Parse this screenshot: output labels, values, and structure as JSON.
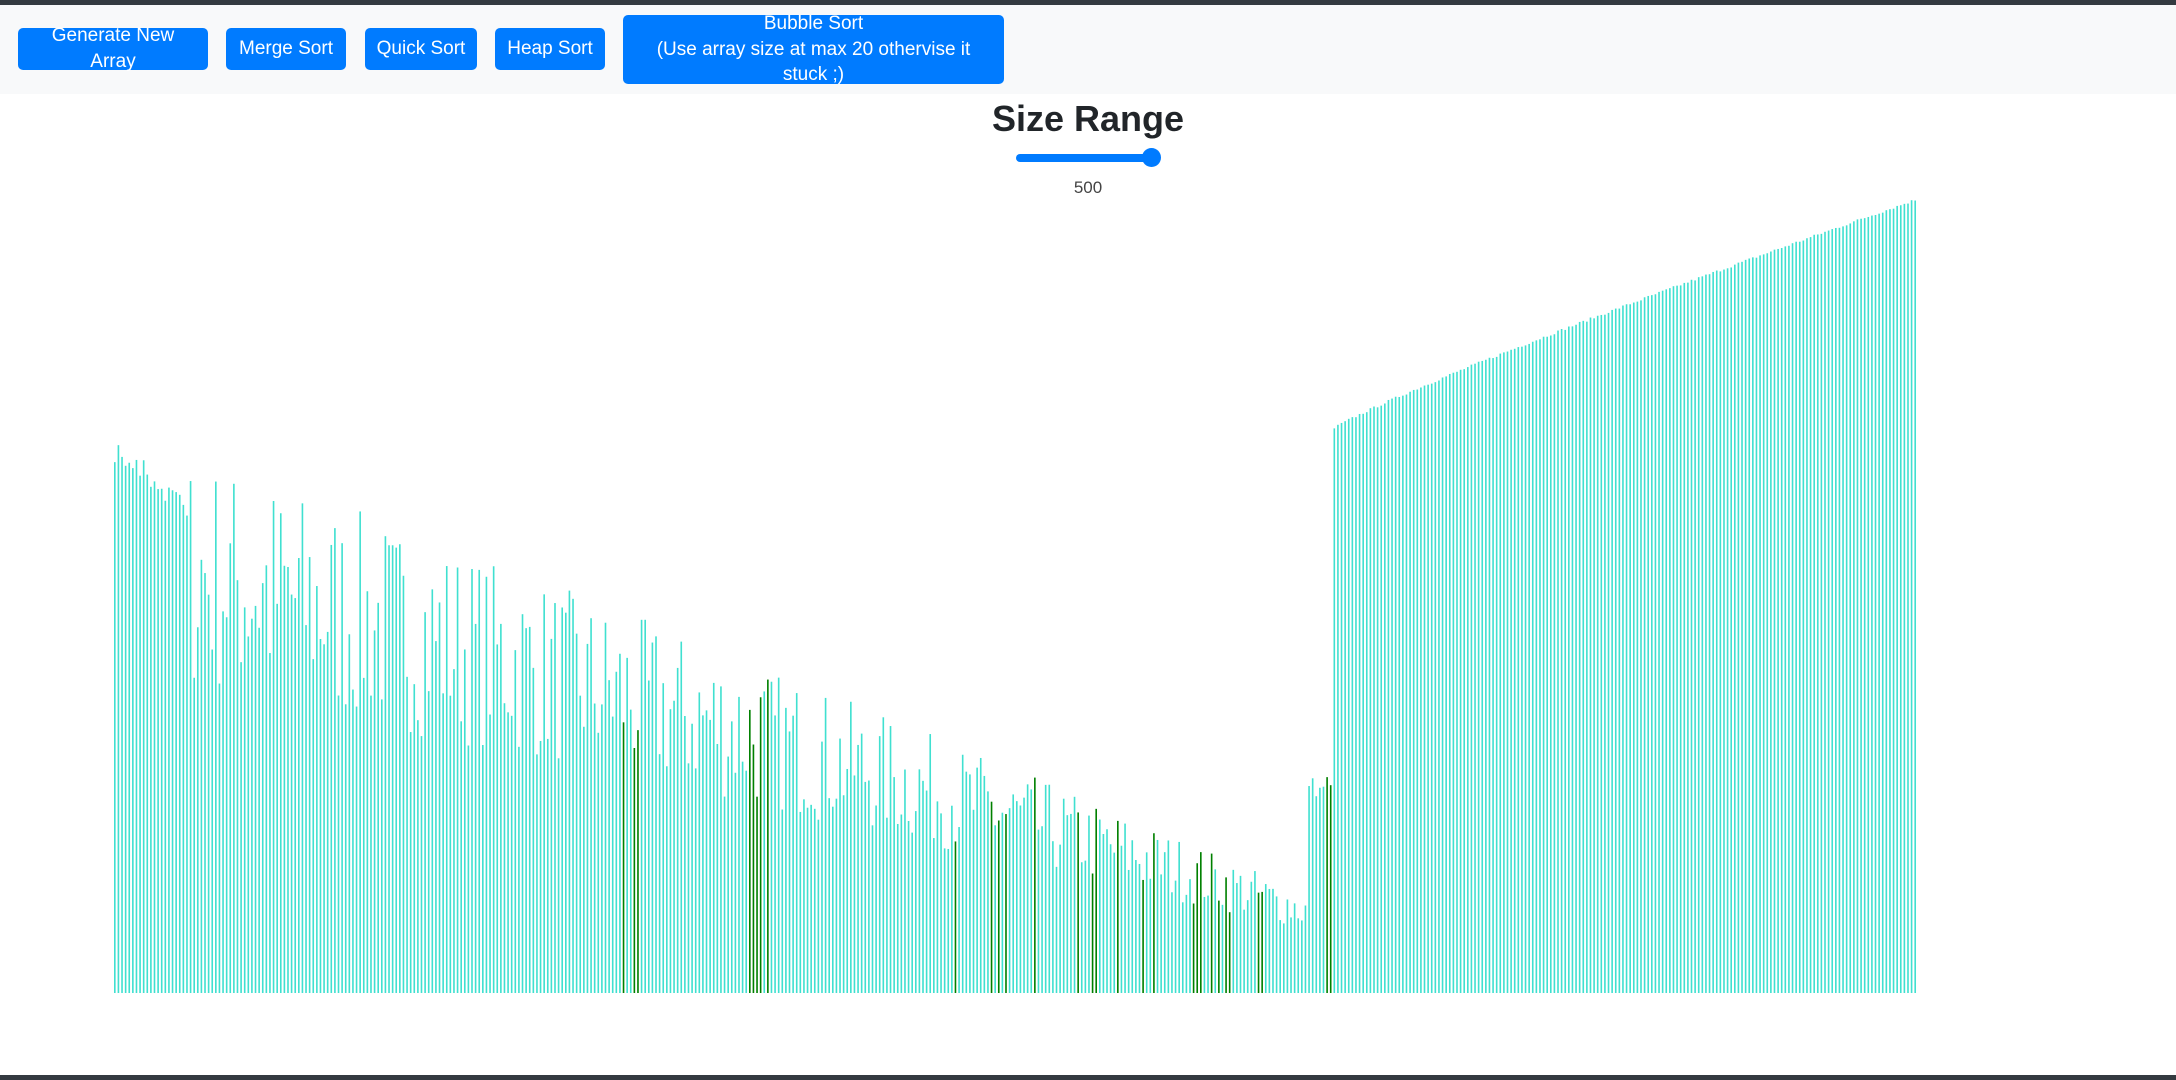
{
  "toolbar": {
    "generate_label": "Generate New Array",
    "merge_label": "Merge Sort",
    "quick_label": "Quick Sort",
    "heap_label": "Heap Sort",
    "bubble_label": "Bubble Sort",
    "bubble_note": "(Use array size at max 20 othervise it stuck ;)"
  },
  "size_range": {
    "title": "Size Range",
    "value": "500",
    "min": 0,
    "max": 500
  },
  "colors": {
    "primary": "#007bff",
    "bar_default": "#40e0d0",
    "bar_active": "#008000",
    "navbar_bg": "#f8f9fa"
  },
  "chart_data": {
    "type": "bar",
    "bar_count": 500,
    "description_colors": [
      "turquoise",
      "green"
    ],
    "regions": {
      "partially_sorted_start": 0,
      "partially_sorted_end": 338,
      "sorted_tail_start": 338,
      "sorted_tail_end": 500
    },
    "value_range": [
      0,
      570
    ],
    "sorted_tail_range": [
      405,
      570
    ],
    "green_bar_indices": [
      141,
      144,
      145,
      176,
      177,
      178,
      179,
      181,
      233,
      243,
      245,
      247,
      255,
      267,
      271,
      272,
      278,
      285,
      288,
      299,
      300,
      301,
      304,
      306,
      308,
      309,
      317,
      318,
      336,
      337
    ]
  }
}
